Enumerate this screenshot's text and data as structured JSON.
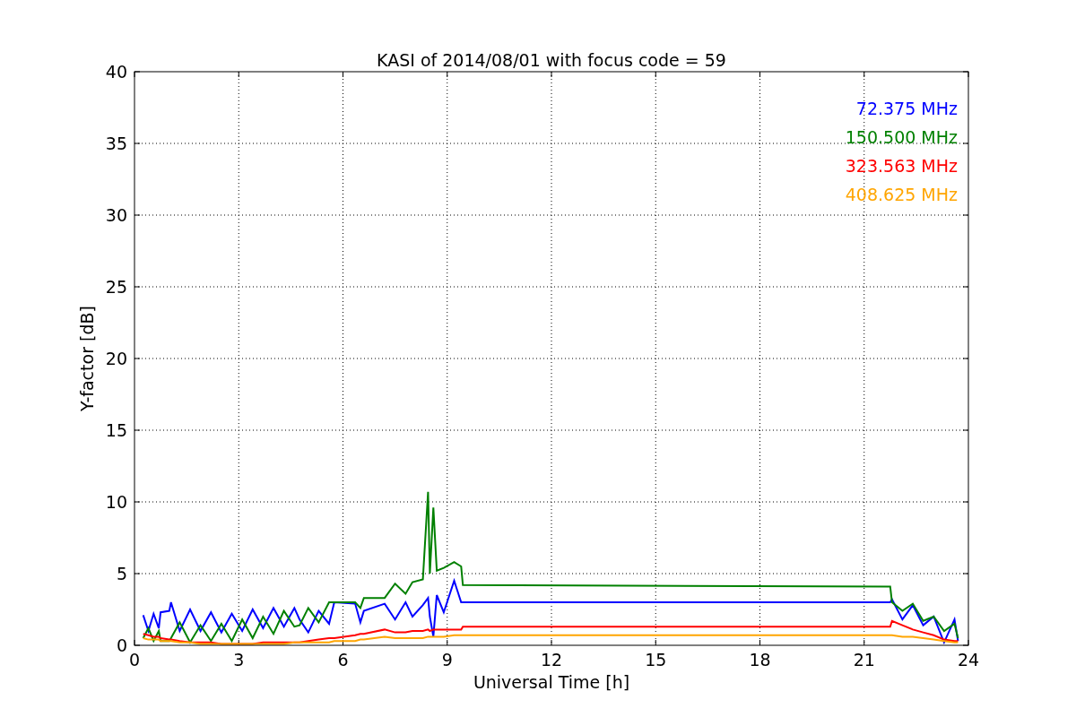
{
  "chart_data": {
    "type": "line",
    "title": "KASI of 2014/08/01 with focus code = 59",
    "xlabel": "Universal Time [h]",
    "ylabel": "Y-factor [dB]",
    "x": [
      0.25,
      0.4,
      0.55,
      0.7,
      0.75,
      1.0,
      1.05,
      1.3,
      1.6,
      1.9,
      2.2,
      2.5,
      2.8,
      3.1,
      3.4,
      3.7,
      4.0,
      4.3,
      4.6,
      4.75,
      5.0,
      5.3,
      5.6,
      5.75,
      6.35,
      6.5,
      6.6,
      7.2,
      7.5,
      7.8,
      8.0,
      8.3,
      8.45,
      8.5,
      8.6,
      8.7,
      8.9,
      9.2,
      9.4,
      9.45,
      21.75,
      21.8,
      22.1,
      22.4,
      22.7,
      23.0,
      23.3,
      23.6,
      23.7
    ],
    "series": [
      {
        "name": "72.375 MHz",
        "color": "#0000ff",
        "values": [
          2.1,
          1.0,
          2.2,
          1.2,
          2.3,
          2.4,
          3.0,
          1.0,
          2.5,
          1.0,
          2.3,
          0.9,
          2.2,
          1.0,
          2.5,
          1.2,
          2.6,
          1.3,
          2.6,
          1.8,
          0.9,
          2.4,
          1.5,
          3.0,
          2.9,
          1.6,
          2.4,
          2.9,
          1.8,
          3.0,
          2.0,
          2.8,
          3.3,
          2.0,
          0.6,
          3.5,
          2.3,
          4.5,
          3.0,
          3.0,
          3.0,
          3.2,
          1.8,
          2.8,
          1.4,
          2.0,
          0.2,
          1.8,
          0.3
        ]
      },
      {
        "name": "150.500 MHz",
        "color": "#008000",
        "values": [
          0.5,
          1.2,
          0.3,
          1.0,
          0.3,
          0.3,
          0.5,
          1.6,
          0.2,
          1.4,
          0.3,
          1.5,
          0.3,
          1.8,
          0.5,
          2.0,
          0.8,
          2.4,
          1.3,
          1.4,
          2.6,
          1.6,
          3.0,
          3.0,
          3.0,
          2.6,
          3.3,
          3.3,
          4.3,
          3.6,
          4.4,
          4.6,
          10.7,
          5.0,
          9.6,
          5.2,
          5.4,
          5.8,
          5.5,
          4.2,
          4.1,
          3.0,
          2.4,
          2.9,
          1.7,
          2.0,
          1.0,
          1.5,
          0.5
        ]
      },
      {
        "name": "323.563 MHz",
        "color": "#ff0000",
        "values": [
          0.8,
          0.7,
          0.6,
          0.6,
          0.5,
          0.4,
          0.4,
          0.3,
          0.2,
          0.2,
          0.2,
          0.1,
          0.1,
          0.1,
          0.1,
          0.2,
          0.2,
          0.2,
          0.2,
          0.2,
          0.3,
          0.4,
          0.5,
          0.5,
          0.7,
          0.8,
          0.8,
          1.1,
          0.9,
          0.9,
          1.0,
          1.0,
          1.1,
          1.0,
          1.1,
          1.1,
          1.1,
          1.1,
          1.1,
          1.3,
          1.3,
          1.7,
          1.4,
          1.1,
          0.9,
          0.7,
          0.4,
          0.3,
          0.3
        ]
      },
      {
        "name": "408.625 MHz",
        "color": "#ffa500",
        "values": [
          0.5,
          0.4,
          0.4,
          0.4,
          0.3,
          0.3,
          0.3,
          0.2,
          0.2,
          0.1,
          0.1,
          0.1,
          0.1,
          0.1,
          0.1,
          0.1,
          0.1,
          0.1,
          0.2,
          0.2,
          0.2,
          0.2,
          0.2,
          0.3,
          0.3,
          0.4,
          0.4,
          0.6,
          0.5,
          0.5,
          0.5,
          0.5,
          0.6,
          0.6,
          0.6,
          0.6,
          0.6,
          0.7,
          0.7,
          0.7,
          0.7,
          0.7,
          0.6,
          0.6,
          0.5,
          0.4,
          0.3,
          0.2,
          0.2
        ]
      }
    ],
    "xlim": [
      0,
      24
    ],
    "ylim": [
      0,
      40
    ],
    "xticks": [
      0,
      3,
      6,
      9,
      12,
      15,
      18,
      21,
      24
    ],
    "yticks": [
      0,
      5,
      10,
      15,
      20,
      25,
      30,
      35,
      40
    ],
    "grid": true
  }
}
